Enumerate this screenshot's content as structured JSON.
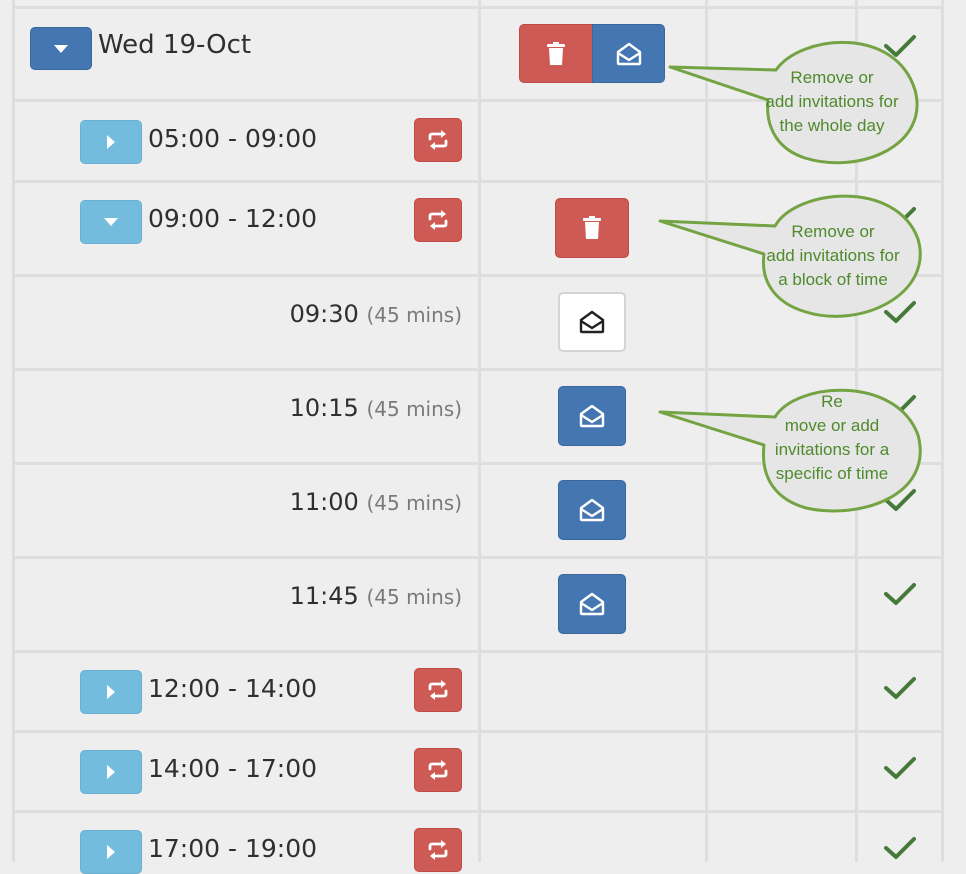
{
  "day": {
    "label": "Wed 19-Oct",
    "expanded": true
  },
  "blocks": [
    {
      "label": "05:00 - 09:00",
      "expanded": false
    },
    {
      "label": "09:00 - 12:00",
      "expanded": true
    },
    {
      "label": "12:00 - 14:00",
      "expanded": false
    },
    {
      "label": "14:00 - 17:00",
      "expanded": false
    },
    {
      "label": "17:00 - 19:00",
      "expanded": false
    }
  ],
  "slots": [
    {
      "time": "09:30",
      "duration": "(45 mins)",
      "invited": false
    },
    {
      "time": "10:15",
      "duration": "(45 mins)",
      "invited": true
    },
    {
      "time": "11:00",
      "duration": "(45 mins)",
      "invited": true
    },
    {
      "time": "11:45",
      "duration": "(45 mins)",
      "invited": true
    }
  ],
  "callouts": [
    {
      "lines": [
        "Remove or",
        "add invitations for",
        "the whole day"
      ]
    },
    {
      "lines": [
        "Remove or",
        "add invitations for",
        "a block of time"
      ]
    },
    {
      "lines": [
        "Re",
        "move or add",
        "invitations for a",
        "specific of time"
      ]
    }
  ],
  "icons": {
    "expand": "caret-down-icon",
    "collapse": "caret-right-icon",
    "delete": "trash-icon",
    "invite": "envelope-open-icon",
    "repeat": "retweet-icon",
    "status": "check-icon"
  },
  "colors": {
    "primary": "#4477b2",
    "info": "#74bcdd",
    "danger": "#cd5a54",
    "success": "#467a3a",
    "callout": "#74a343"
  }
}
